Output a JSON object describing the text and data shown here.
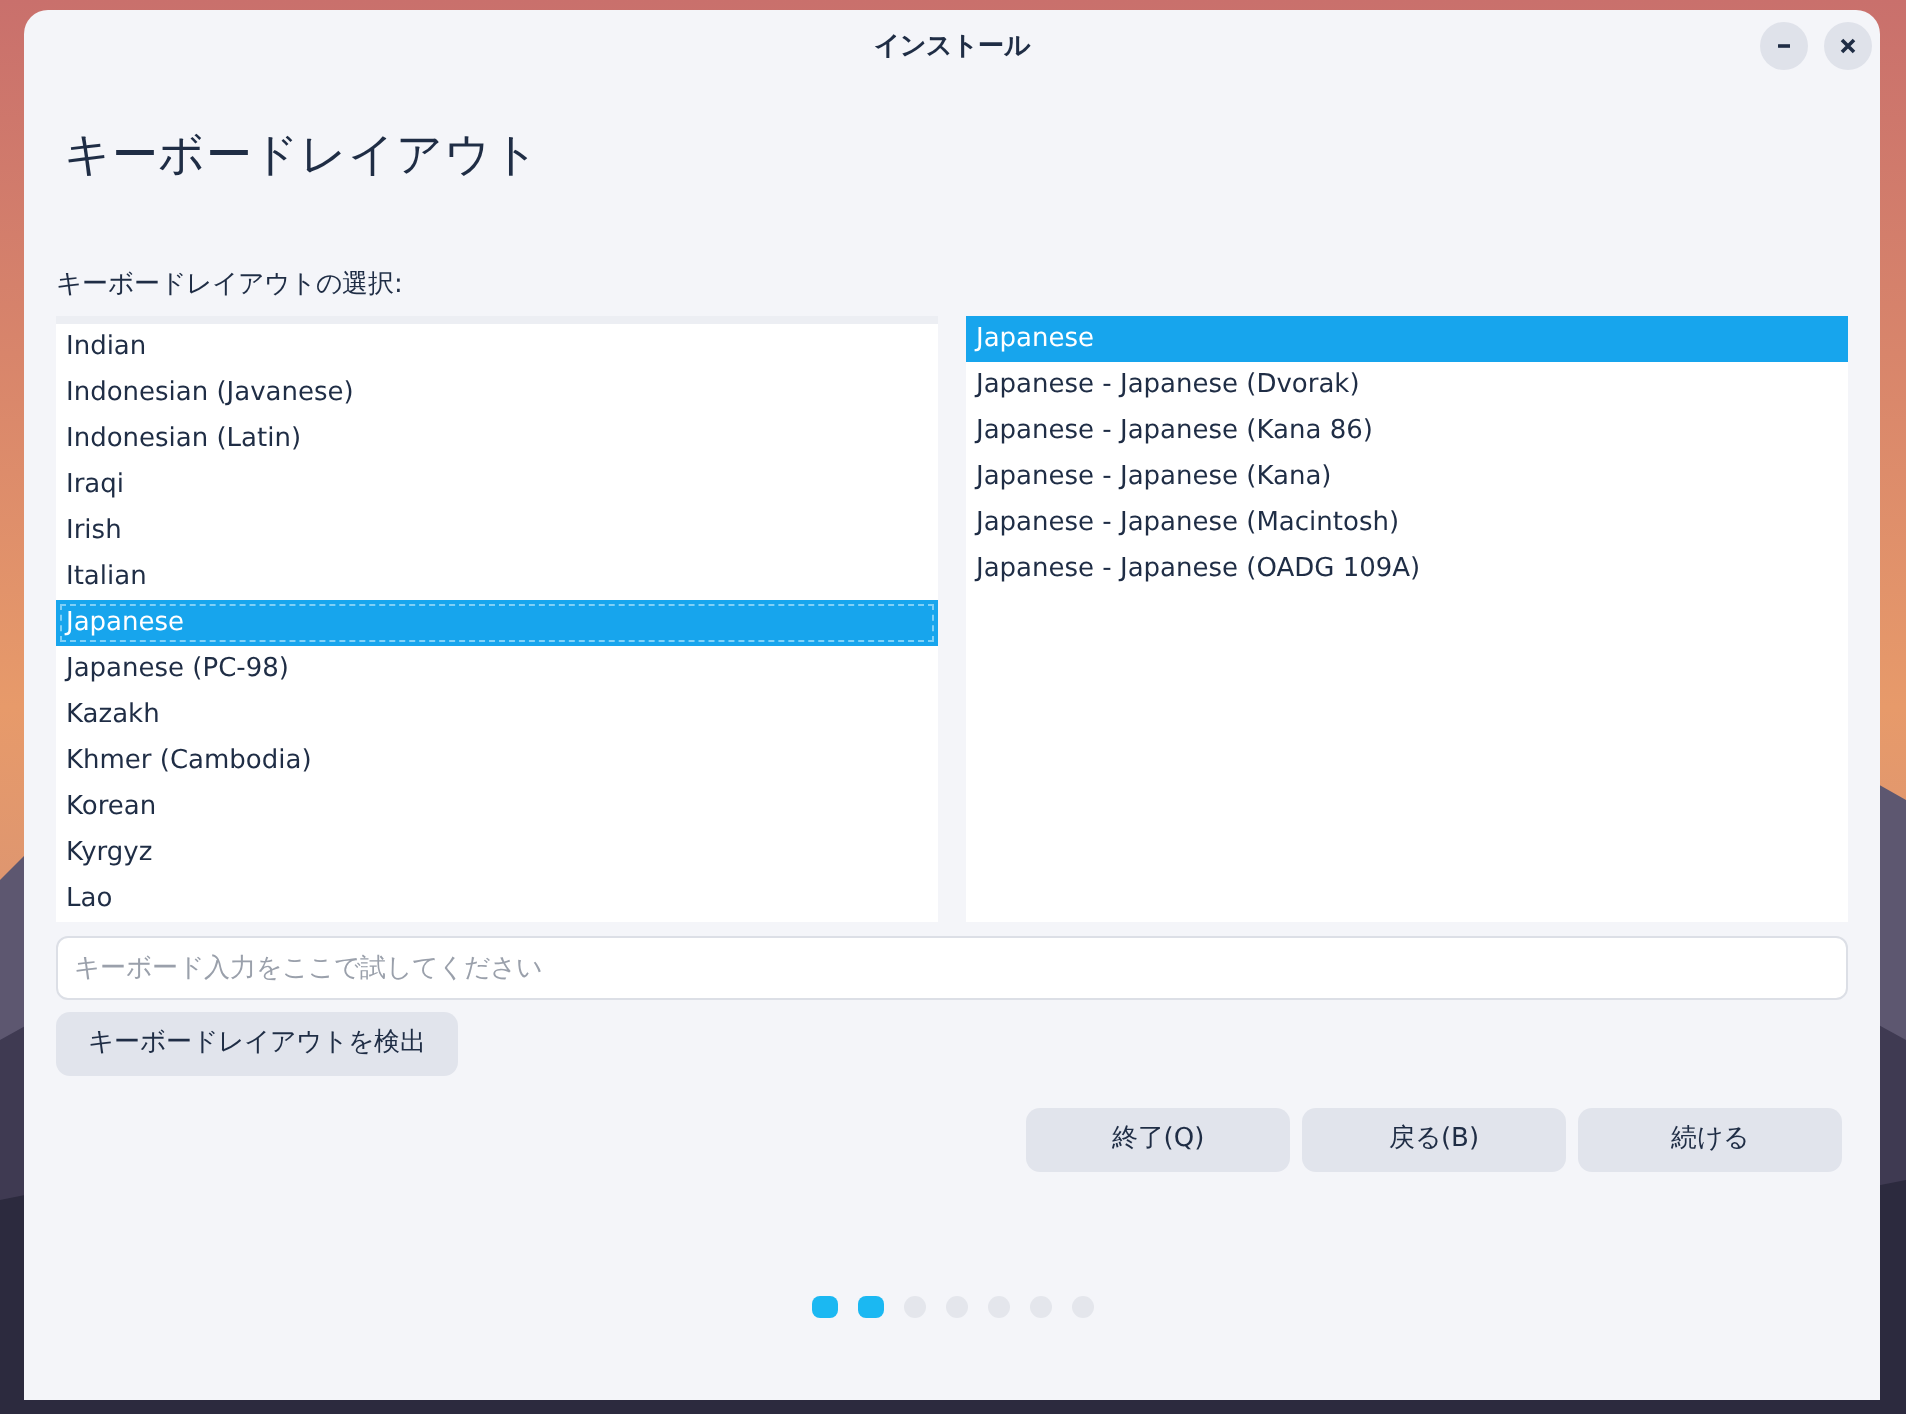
{
  "window": {
    "title": "インストール",
    "controls": [
      {
        "kind": "minimize"
      },
      {
        "kind": "close"
      }
    ]
  },
  "page_title": "キーボードレイアウト",
  "layout_label": "キーボードレイアウトの選択:",
  "layouts": [
    {
      "label": "Indian",
      "selected": false
    },
    {
      "label": "Indonesian (Javanese)",
      "selected": false
    },
    {
      "label": "Indonesian (Latin)",
      "selected": false
    },
    {
      "label": "Iraqi",
      "selected": false
    },
    {
      "label": "Irish",
      "selected": false
    },
    {
      "label": "Italian",
      "selected": false
    },
    {
      "label": "Japanese",
      "selected": true
    },
    {
      "label": "Japanese (PC-98)",
      "selected": false
    },
    {
      "label": "Kazakh",
      "selected": false
    },
    {
      "label": "Khmer (Cambodia)",
      "selected": false
    },
    {
      "label": "Korean",
      "selected": false
    },
    {
      "label": "Kyrgyz",
      "selected": false
    },
    {
      "label": "Lao",
      "selected": false
    }
  ],
  "variants": [
    {
      "label": "Japanese",
      "selected": true
    },
    {
      "label": "Japanese - Japanese (Dvorak)",
      "selected": false
    },
    {
      "label": "Japanese - Japanese (Kana 86)",
      "selected": false
    },
    {
      "label": "Japanese - Japanese (Kana)",
      "selected": false
    },
    {
      "label": "Japanese - Japanese (Macintosh)",
      "selected": false
    },
    {
      "label": "Japanese - Japanese (OADG 109A)",
      "selected": false
    }
  ],
  "test_field": {
    "placeholder": "キーボード入力をここで試してください"
  },
  "detect_button": "キーボードレイアウトを検出",
  "buttons": [
    "終了(Q)",
    "戻る(B)",
    "続ける"
  ],
  "steps": [
    {
      "active": true
    },
    {
      "active": true
    },
    {
      "active": false
    },
    {
      "active": false
    },
    {
      "active": false
    },
    {
      "active": false
    },
    {
      "active": false
    }
  ]
}
